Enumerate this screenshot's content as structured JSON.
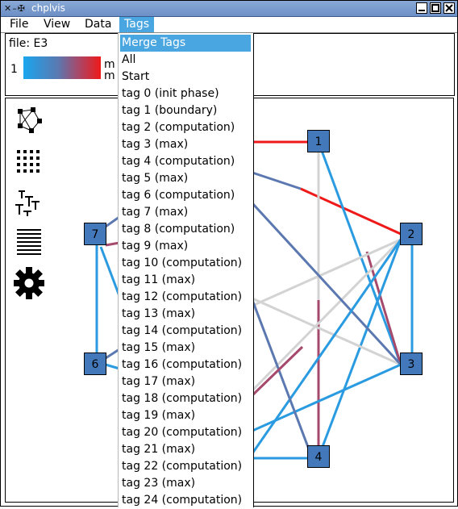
{
  "window": {
    "title": "chplvis"
  },
  "menubar": {
    "items": [
      "File",
      "View",
      "Data",
      "Tags"
    ],
    "active": "Tags"
  },
  "info": {
    "file_label": "file: E3",
    "scale_min": "1",
    "scale_max_line1": "m",
    "scale_max_line2": "m"
  },
  "toolbar": {
    "tools": [
      "graph-view",
      "grid-view",
      "tree-view",
      "list-view",
      "settings"
    ]
  },
  "graph": {
    "nodes": [
      {
        "id": "1",
        "label": "1"
      },
      {
        "id": "2",
        "label": "2"
      },
      {
        "id": "3",
        "label": "3"
      },
      {
        "id": "4",
        "label": "4"
      },
      {
        "id": "6",
        "label": "6"
      },
      {
        "id": "7",
        "label": "7"
      }
    ],
    "colors": {
      "low": "#19a6ee",
      "mid": "#5b78b0",
      "high_mid": "#a54a6c",
      "high": "#ee1a1a",
      "neutral": "#d3d3d3",
      "node": "#4379bb"
    }
  },
  "tags_menu": {
    "items": [
      "Merge Tags",
      "All",
      "Start",
      "tag 0 (init phase)",
      "tag 1 (boundary)",
      "tag 2 (computation)",
      "tag 3 (max)",
      "tag 4 (computation)",
      "tag 5 (max)",
      "tag 6 (computation)",
      "tag 7 (max)",
      "tag 8 (computation)",
      "tag 9 (max)",
      "tag 10 (computation)",
      "tag 11 (max)",
      "tag 12 (computation)",
      "tag 13 (max)",
      "tag 14 (computation)",
      "tag 15 (max)",
      "tag 16 (computation)",
      "tag 17 (max)",
      "tag 18 (computation)",
      "tag 19 (max)",
      "tag 20 (computation)",
      "tag 21 (max)",
      "tag 22 (computation)",
      "tag 23 (max)",
      "tag 24 (computation)"
    ],
    "selected": "Merge Tags"
  }
}
